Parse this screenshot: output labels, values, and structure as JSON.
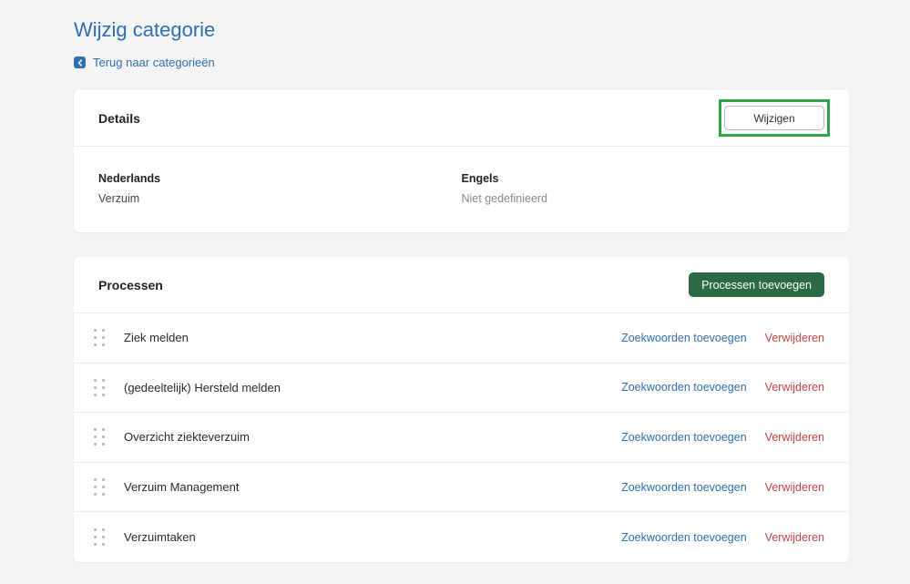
{
  "page": {
    "title": "Wijzig categorie",
    "back_link": "Terug naar categorieën"
  },
  "details": {
    "title": "Details",
    "edit_label": "Wijzigen",
    "fields": [
      {
        "label": "Nederlands",
        "value": "Verzuim"
      },
      {
        "label": "Engels",
        "value": "Niet gedefinieerd"
      }
    ]
  },
  "processes": {
    "title": "Processen",
    "add_label": "Processen toevoegen",
    "keywords_label": "Zoekwoorden toevoegen",
    "delete_label": "Verwijderen",
    "items": [
      {
        "name": "Ziek melden"
      },
      {
        "name": "(gedeeltelijk) Hersteld melden"
      },
      {
        "name": "Overzicht ziekteverzuim"
      },
      {
        "name": "Verzuim Management"
      },
      {
        "name": "Verzuimtaken"
      }
    ]
  },
  "colors": {
    "accent": "#2f6fb0",
    "primary_button": "#2b6a45",
    "danger": "#c44343",
    "highlight": "#2ea44f"
  }
}
